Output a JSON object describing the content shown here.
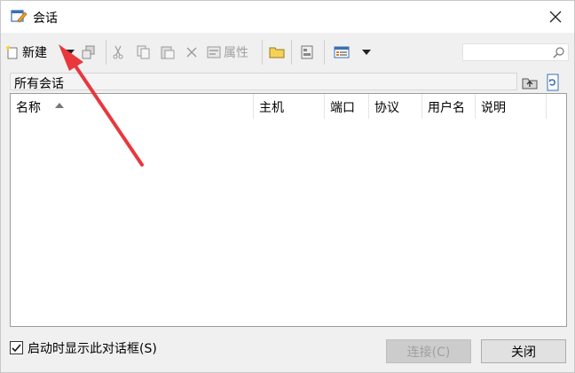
{
  "window": {
    "title": "会话"
  },
  "toolbar": {
    "new_label": "新建",
    "properties_label": "属性",
    "search_placeholder": ""
  },
  "path": {
    "label": "所有会话"
  },
  "table": {
    "columns": [
      "名称",
      "主机",
      "端口",
      "协议",
      "用户名",
      "说明"
    ],
    "rows": []
  },
  "footer": {
    "show_on_startup_label": "启动时显示此对话框(S)",
    "show_on_startup_checked": true,
    "connect_label": "连接(C)",
    "close_label": "关闭"
  },
  "colors": {
    "annotation_arrow": "#e8383d"
  }
}
